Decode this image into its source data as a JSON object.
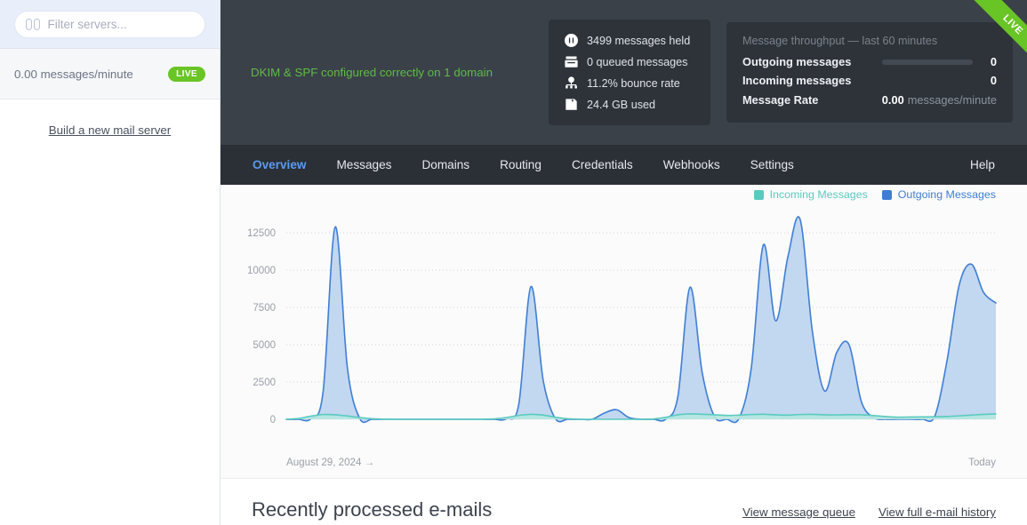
{
  "sidebar": {
    "search": {
      "placeholder": "Filter servers...",
      "value": "",
      "icon": "servers-icon"
    },
    "rate_text": "0.00 messages/minute",
    "live_badge": "LIVE",
    "build_link": "Build a new mail server"
  },
  "header": {
    "dkim_message": "DKIM & SPF configured correctly on 1 domain",
    "dkim_color": "#5fbb46",
    "ribbon_label": "LIVE",
    "ribbon_color": "#69c425",
    "stats": [
      {
        "icon": "pause-circle-icon",
        "text": "3499 messages held"
      },
      {
        "icon": "inbox-icon",
        "text": "0 queued messages"
      },
      {
        "icon": "sitemap-icon",
        "text": "11.2% bounce rate"
      },
      {
        "icon": "floppy-disk-icon",
        "text": "24.4 GB used"
      }
    ],
    "throughput": {
      "title": "Message throughput — last 60 minutes",
      "rows": [
        {
          "label": "Outgoing messages",
          "value": "0",
          "bar": true
        },
        {
          "label": "Incoming messages",
          "value": "0",
          "bar": false
        }
      ],
      "rate_label": "Message Rate",
      "rate_value": "0.00",
      "rate_unit": "messages/minute"
    }
  },
  "nav": {
    "items": [
      {
        "label": "Overview",
        "active": true
      },
      {
        "label": "Messages",
        "active": false
      },
      {
        "label": "Domains",
        "active": false
      },
      {
        "label": "Routing",
        "active": false
      },
      {
        "label": "Credentials",
        "active": false
      },
      {
        "label": "Webhooks",
        "active": false
      },
      {
        "label": "Settings",
        "active": false
      }
    ],
    "help": "Help",
    "active_color": "#5b9bf0"
  },
  "chart_data": {
    "type": "area",
    "title": "",
    "xlabel": "",
    "ylabel": "",
    "ylim": [
      0,
      13700
    ],
    "yticks": [
      0,
      2500,
      5000,
      7500,
      10000,
      12500
    ],
    "ytick_labels": [
      "0",
      "2500",
      "5000",
      "7500",
      "10000",
      "12500"
    ],
    "grid": true,
    "x_start_label": "August 29, 2024 →",
    "x_end_label": "Today",
    "legend_position": "top-right",
    "legend": [
      {
        "name": "Incoming Messages",
        "color": "#59cbbe"
      },
      {
        "name": "Outgoing Messages",
        "color": "#3e7fd4"
      }
    ],
    "series": [
      {
        "name": "Outgoing Messages",
        "color": "#3e7fd4",
        "fill": "#bdd4ef",
        "values": [
          0,
          0,
          40,
          1800,
          12900,
          3400,
          60,
          0,
          0,
          0,
          0,
          0,
          0,
          0,
          0,
          0,
          0,
          0,
          30,
          1000,
          8900,
          2600,
          40,
          0,
          0,
          0,
          420,
          640,
          120,
          0,
          0,
          0,
          1500,
          8850,
          3100,
          180,
          0,
          60,
          3400,
          11700,
          6600,
          10900,
          13400,
          5900,
          1900,
          4500,
          5000,
          1200,
          120,
          0,
          0,
          0,
          0,
          200,
          3900,
          9000,
          10400,
          8500,
          7800
        ]
      },
      {
        "name": "Incoming Messages",
        "color": "#59cbbe",
        "fill": "#b6e6e0",
        "values": [
          0,
          60,
          210,
          320,
          300,
          220,
          120,
          40,
          10,
          0,
          0,
          0,
          0,
          0,
          0,
          0,
          0,
          30,
          120,
          260,
          330,
          280,
          140,
          40,
          0,
          0,
          0,
          0,
          0,
          0,
          20,
          130,
          300,
          360,
          340,
          300,
          260,
          280,
          320,
          340,
          300,
          280,
          320,
          330,
          300,
          290,
          310,
          300,
          250,
          180,
          140,
          150,
          160,
          170,
          190,
          230,
          280,
          330,
          360
        ]
      }
    ]
  },
  "recent": {
    "title": "Recently processed e-mails",
    "links": [
      "View message queue",
      "View full e-mail history"
    ]
  }
}
